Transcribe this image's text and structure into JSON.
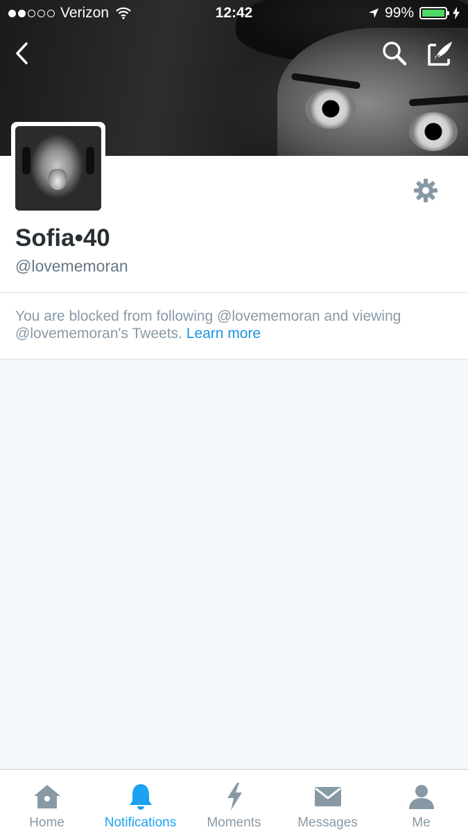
{
  "status_bar": {
    "carrier": "Verizon",
    "signal_bars_filled": 2,
    "signal_bars_total": 5,
    "time": "12:42",
    "battery_percent_label": "99%",
    "battery_level": 0.99
  },
  "header": {
    "back_icon": "chevron-left-icon",
    "search_icon": "search-icon",
    "compose_icon": "compose-icon"
  },
  "profile": {
    "display_name": "Sofia•40",
    "handle": "@lovememoran",
    "settings_icon": "gear-icon"
  },
  "notice": {
    "text": "You are blocked from following @lovememoran and viewing @lovememoran's Tweets.",
    "link_text": "Learn more"
  },
  "tab_bar": {
    "tabs": [
      {
        "label": "Home",
        "icon": "home-icon"
      },
      {
        "label": "Notifications",
        "icon": "bell-icon"
      },
      {
        "label": "Moments",
        "icon": "lightning-icon"
      },
      {
        "label": "Messages",
        "icon": "envelope-icon"
      },
      {
        "label": "Me",
        "icon": "person-icon"
      }
    ],
    "active": "Notifications"
  },
  "colors": {
    "accent": "#1da1f2",
    "link": "#1b95e0",
    "muted_text": "#8899a6",
    "name_text": "#292f33",
    "background": "#f5f8fa",
    "battery_green": "#4cd964"
  }
}
